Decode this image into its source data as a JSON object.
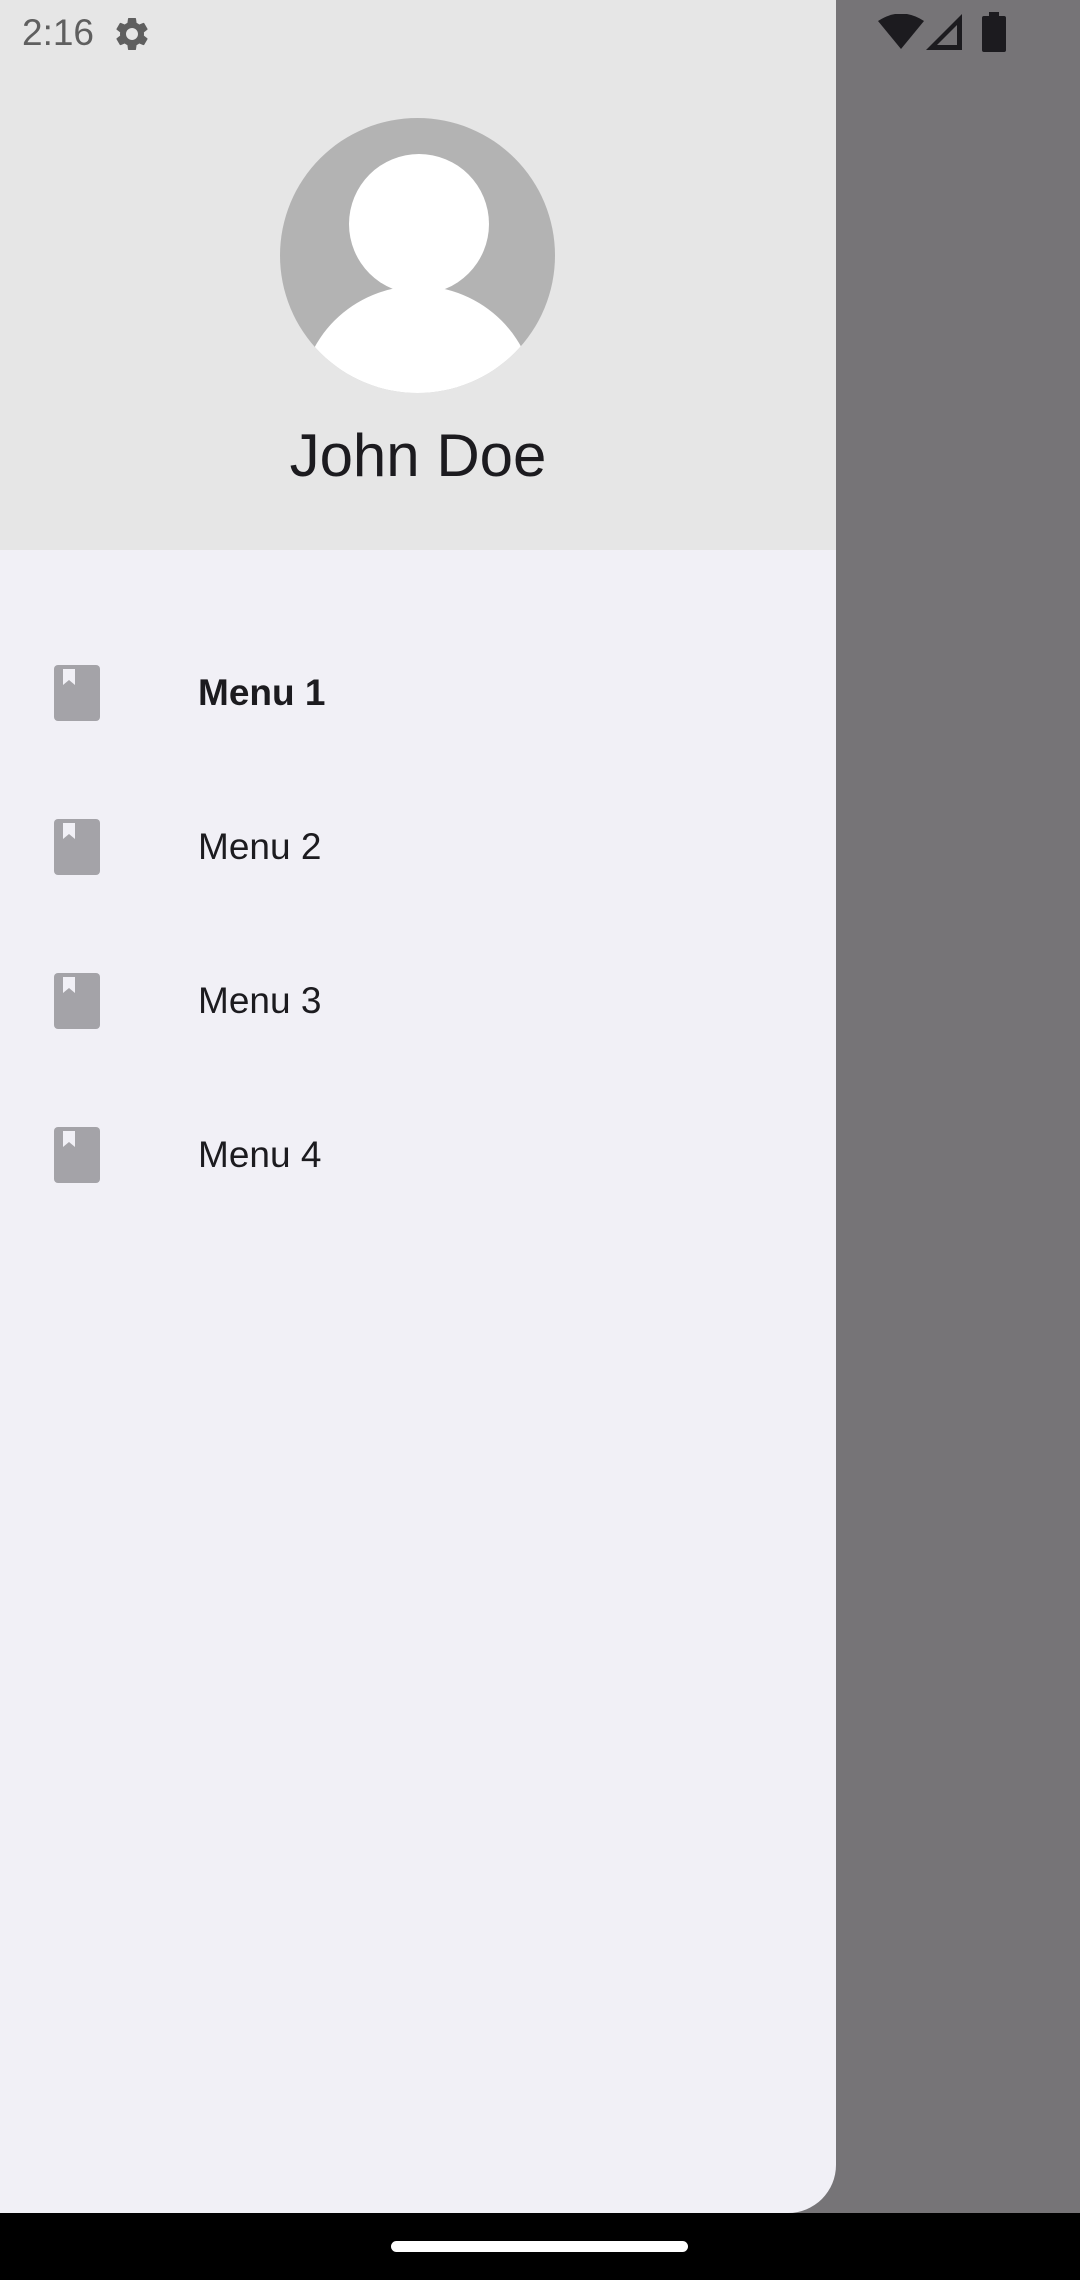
{
  "status_bar": {
    "time": "2:16",
    "icons": [
      "gear-icon",
      "wifi-icon",
      "cellular-signal-icon",
      "battery-icon"
    ]
  },
  "drawer": {
    "header": {
      "avatar": "avatar-placeholder-icon",
      "user_name": "John Doe"
    },
    "menu_items": [
      {
        "label": "Menu 1",
        "icon": "book-icon",
        "selected": true
      },
      {
        "label": "Menu 2",
        "icon": "book-icon",
        "selected": false
      },
      {
        "label": "Menu 3",
        "icon": "book-icon",
        "selected": false
      },
      {
        "label": "Menu 4",
        "icon": "book-icon",
        "selected": false
      }
    ]
  },
  "colors": {
    "drawer_background": "#f1f0f6",
    "header_background": "#e6e6e6",
    "scrim": "#767477",
    "icon": "#a4a3a8",
    "text": "#1c1b1f"
  }
}
